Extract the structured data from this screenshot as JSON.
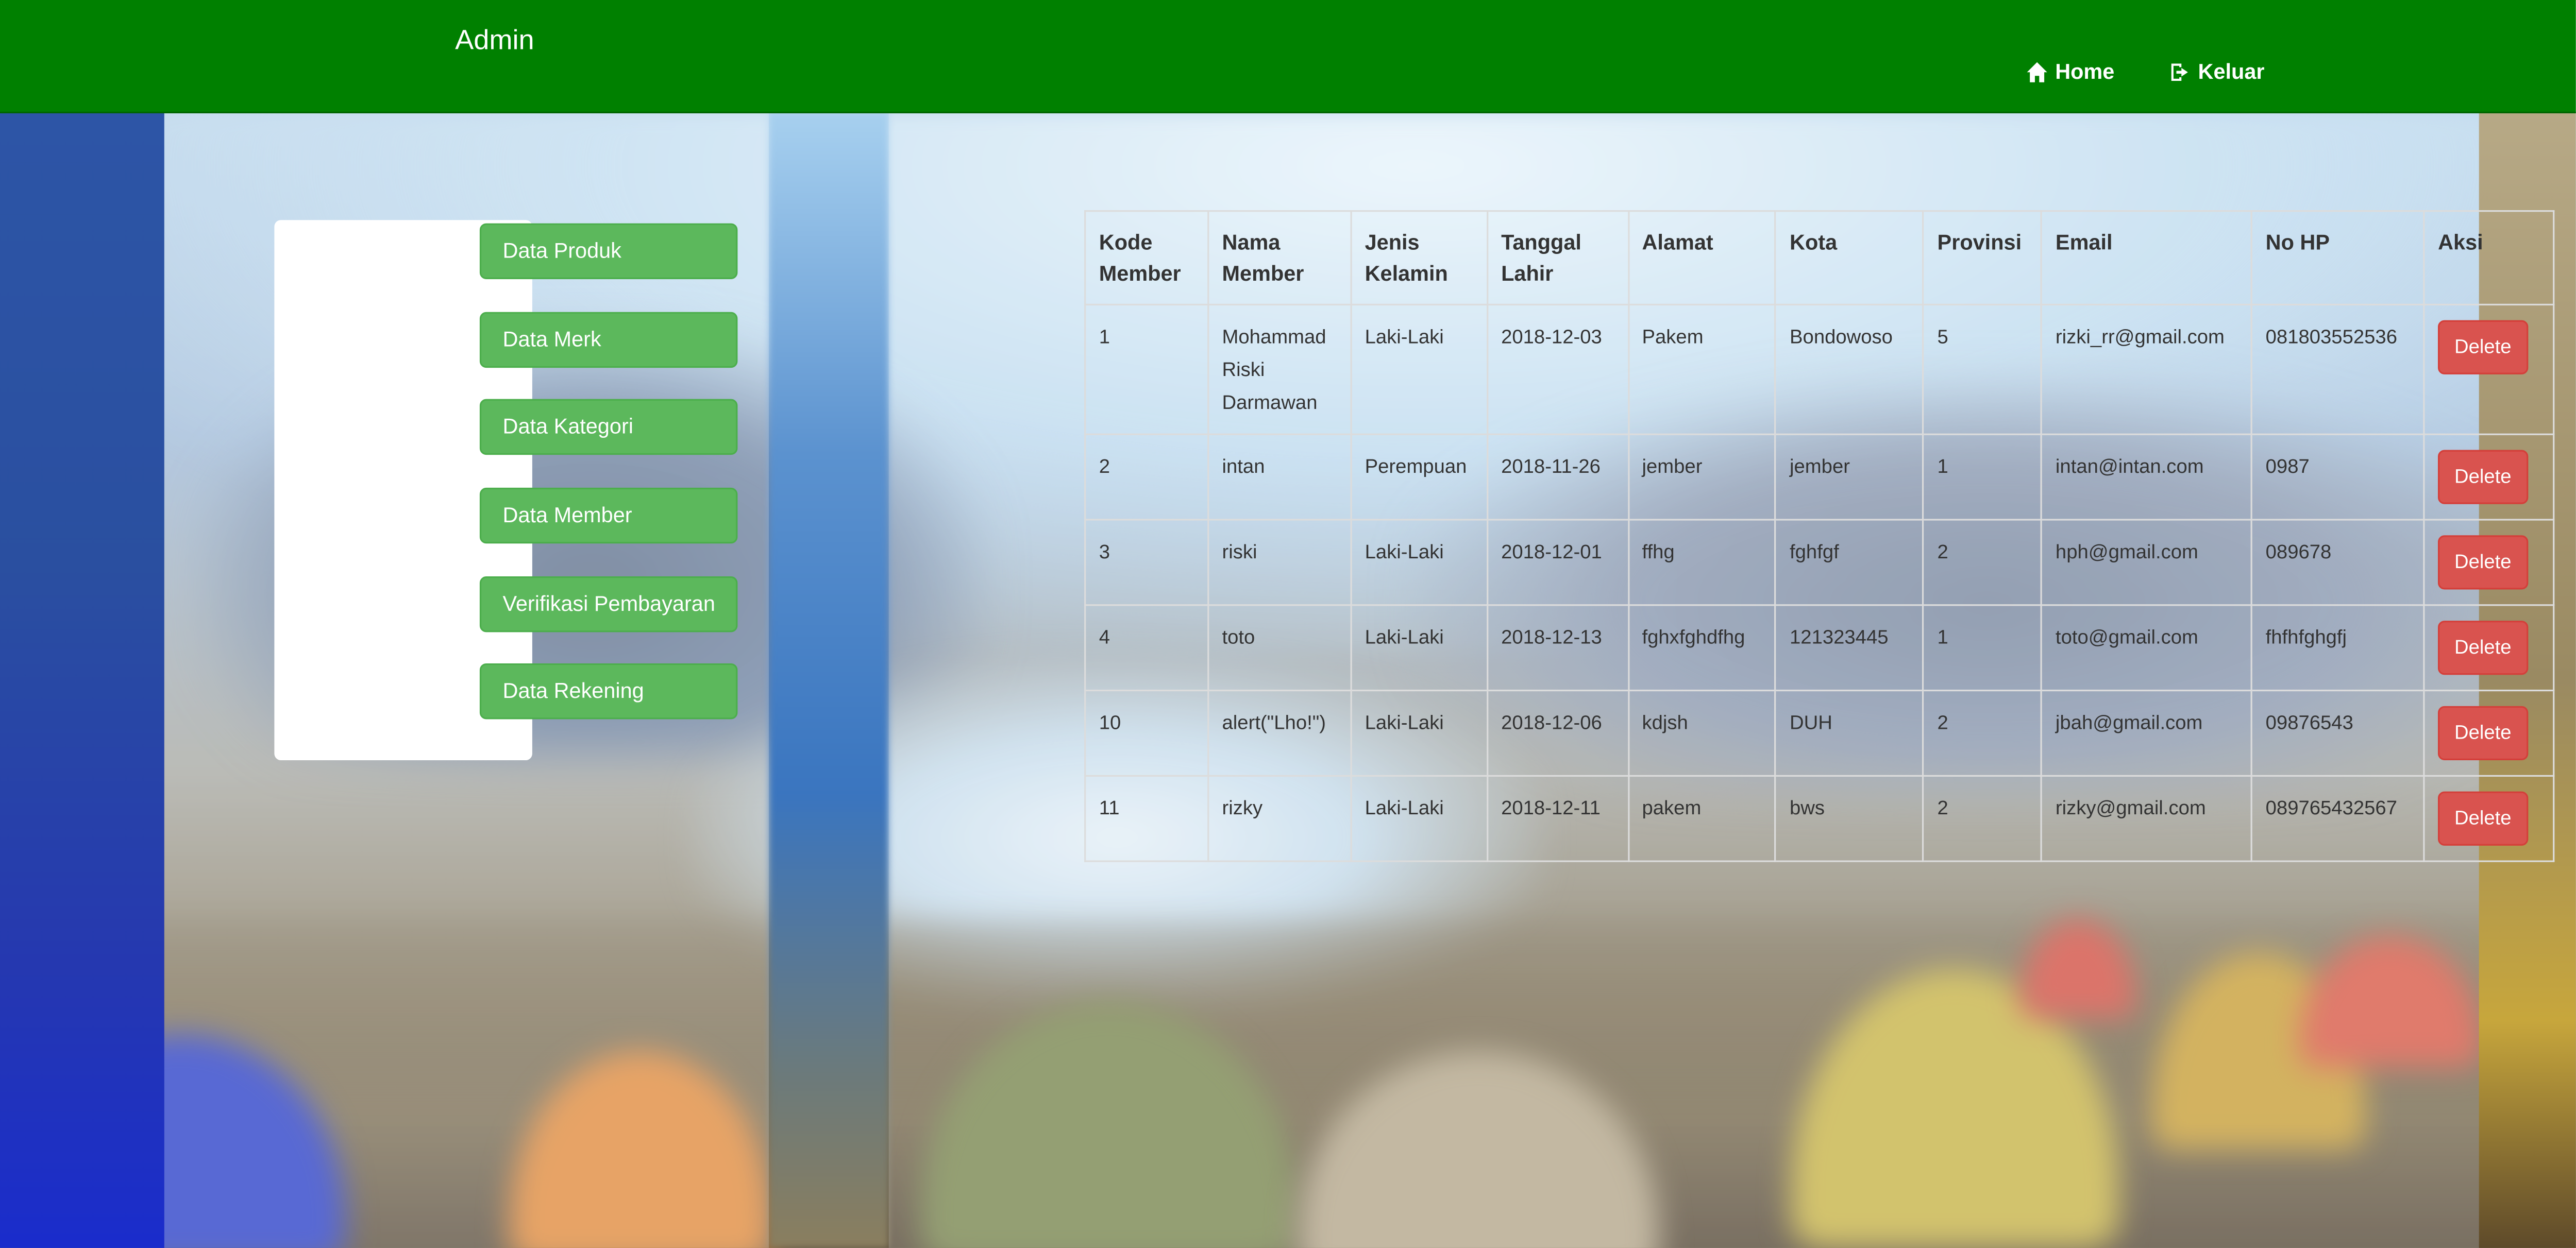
{
  "navbar": {
    "brand": "Admin",
    "home_label": "Home",
    "logout_label": "Keluar",
    "home_icon": "home-icon",
    "logout_icon": "logout-icon",
    "background_color": "#008000"
  },
  "sidebar": {
    "items": [
      {
        "label": "Data Produk"
      },
      {
        "label": "Data Merk"
      },
      {
        "label": "Data Kategori"
      },
      {
        "label": "Data Member"
      },
      {
        "label": "Verifikasi Pembayaran"
      },
      {
        "label": "Data Rekening"
      }
    ],
    "button_color": "#5cb85c"
  },
  "table": {
    "headers": [
      "Kode Member",
      "Nama Member",
      "Jenis Kelamin",
      "Tanggal Lahir",
      "Alamat",
      "Kota",
      "Provinsi",
      "Email",
      "No HP",
      "Aksi"
    ],
    "rows": [
      {
        "kode": "1",
        "nama": "Mohammad Riski Darmawan",
        "jk": "Laki-Laki",
        "tgl": "2018-12-03",
        "alamat": "Pakem",
        "kota": "Bondowoso",
        "provinsi": "5",
        "email": "rizki_rr@gmail.com",
        "hp": "081803552536"
      },
      {
        "kode": "2",
        "nama": "intan",
        "jk": "Perempuan",
        "tgl": "2018-11-26",
        "alamat": "jember",
        "kota": "jember",
        "provinsi": "1",
        "email": "intan@intan.com",
        "hp": "0987"
      },
      {
        "kode": "3",
        "nama": "riski",
        "jk": "Laki-Laki",
        "tgl": "2018-12-01",
        "alamat": "ffhg",
        "kota": "fghfgf",
        "provinsi": "2",
        "email": "hph@gmail.com",
        "hp": "089678"
      },
      {
        "kode": "4",
        "nama": "toto",
        "jk": "Laki-Laki",
        "tgl": "2018-12-13",
        "alamat": "fghxfghdfhg",
        "kota": "121323445",
        "provinsi": "1",
        "email": "toto@gmail.com",
        "hp": "fhfhfghgfj"
      },
      {
        "kode": "10",
        "nama": "alert(\"Lho!\")",
        "jk": "Laki-Laki",
        "tgl": "2018-12-06",
        "alamat": "kdjsh",
        "kota": "DUH",
        "provinsi": "2",
        "email": "jbah@gmail.com",
        "hp": "09876543"
      },
      {
        "kode": "11",
        "nama": "rizky",
        "jk": "Laki-Laki",
        "tgl": "2018-12-11",
        "alamat": "pakem",
        "kota": "bws",
        "provinsi": "2",
        "email": "rizky@gmail.com",
        "hp": "089765432567"
      }
    ],
    "delete_label": "Delete",
    "delete_color": "#d9534f"
  }
}
